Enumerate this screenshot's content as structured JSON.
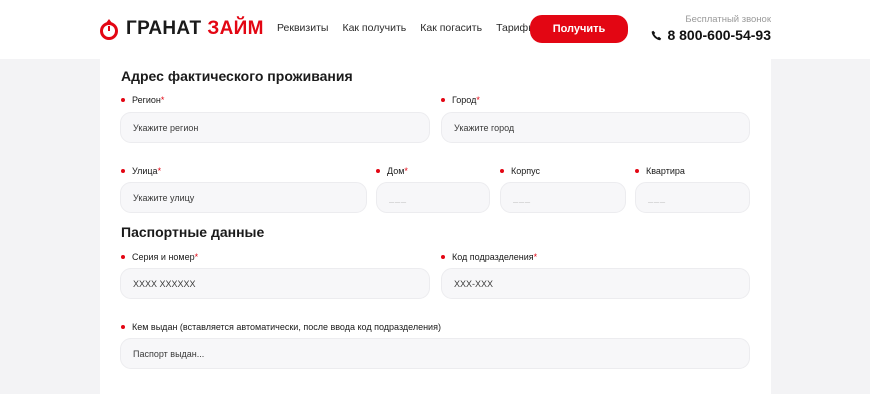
{
  "header": {
    "logo": {
      "word1": "ГРАНАТ",
      "word2": "ЗАЙМ"
    },
    "nav": [
      "Реквизиты",
      "Как получить",
      "Как погасить",
      "Тарифы"
    ],
    "cta_label": "Получить",
    "hotline_label": "Бесплатный звонок",
    "phone": "8 800-600-54-93"
  },
  "address": {
    "title": "Адрес фактического проживания",
    "region": {
      "label": "Регион",
      "required": "*",
      "placeholder": "Укажите регион"
    },
    "city": {
      "label": "Город",
      "required": "*",
      "placeholder": "Укажите город"
    },
    "street": {
      "label": "Улица",
      "required": "*",
      "placeholder": "Укажите улицу"
    },
    "house": {
      "label": "Дом",
      "required": "*",
      "placeholder": "___"
    },
    "building": {
      "label": "Корпус",
      "placeholder": "___"
    },
    "apartment": {
      "label": "Квартира",
      "placeholder": "___"
    }
  },
  "passport": {
    "title": "Паспортные данные",
    "series": {
      "label": "Серия и номер",
      "required": "*",
      "placeholder": "XXXX XXXXXX"
    },
    "division_code": {
      "label": "Код подразделения",
      "required": "*",
      "placeholder": "XXX-XXX"
    },
    "issued_by": {
      "label": "Кем выдан (вставляется автоматически, после ввода код подразделения)",
      "placeholder": "Паспорт выдан..."
    }
  },
  "colors": {
    "accent": "#e30613",
    "background": "#f3f3f5",
    "field_bg": "#f7f7f9"
  }
}
